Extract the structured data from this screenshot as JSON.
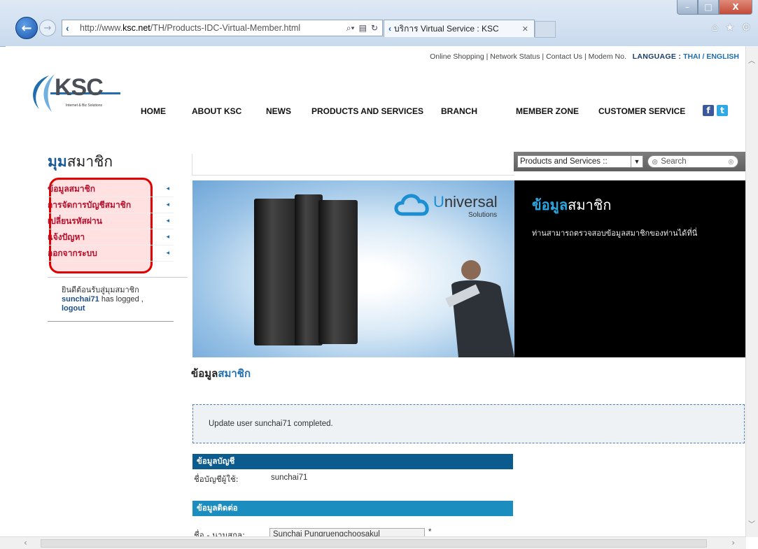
{
  "browser": {
    "url_prefix": "http://www.",
    "url_domain": "ksc.net",
    "url_path": "/TH/Products-IDC-Virtual-Member.html",
    "tab_title": "บริการ Virtual Service : KSC",
    "win_min": "–",
    "win_max": "□",
    "win_close": "X"
  },
  "top_links": {
    "online_shopping": "Online Shopping",
    "network_status": "Network Status",
    "contact_us": "Contact Us",
    "modem_no": "Modem No.",
    "language_label": "LANGUAGE :",
    "thai": "THAI",
    "english": "ENGLISH",
    "sep": "|",
    "slash": "/"
  },
  "logo": {
    "text": "KSC",
    "tagline": "Internet & Biz Solutions"
  },
  "nav": {
    "home": "HOME",
    "about": "ABOUT KSC",
    "news": "NEWS",
    "products": "PRODUCTS AND SERVICES",
    "branch": "BRANCH",
    "member_zone": "MEMBER ZONE",
    "customer_service": "CUSTOMER SERVICE"
  },
  "member": {
    "title_bold": "มุม",
    "title_rest": "สมาชิก"
  },
  "search": {
    "select_value": "Products and Services ::",
    "placeholder": "Search"
  },
  "sidebar": {
    "items": [
      {
        "label": "ข้อมูลสมาชิก"
      },
      {
        "label": "การจัดการบัญชีสมาชิก"
      },
      {
        "label": "เปลี่ยนรหัสผ่าน"
      },
      {
        "label": "แจ้งปัญหา"
      },
      {
        "label": "ออกจากระบบ"
      }
    ],
    "welcome_text": "ยินดีต้อนรับสู่มุมสมาชิก",
    "username": "sunchai71",
    "logged_text": "has logged ,",
    "logout": "logout"
  },
  "banner": {
    "brand_u": "U",
    "brand_rest": "niversal",
    "brand_sub": "Solutions",
    "title_bold": "ข้อมูล",
    "title_rest": "สมาชิก",
    "description": "ท่านสามารถตรวจสอบข้อมูลสมาชิกของท่านได้ที่นี่"
  },
  "content": {
    "title_black": "ข้อมูล",
    "title_blue": "สมาชิก",
    "notice": "Update user sunchai71 completed.",
    "section_account": "ข้อมูลบัญชี",
    "username_label": "ชื่อบัญชีผู้ใช้:",
    "username_value": "sunchai71",
    "section_contact": "ข้อมูลติดต่อ",
    "name_label": "ชื่อ - นามสกุล:",
    "name_value": "Sunchai Pungruengchoosakul",
    "required_mark": "*"
  }
}
